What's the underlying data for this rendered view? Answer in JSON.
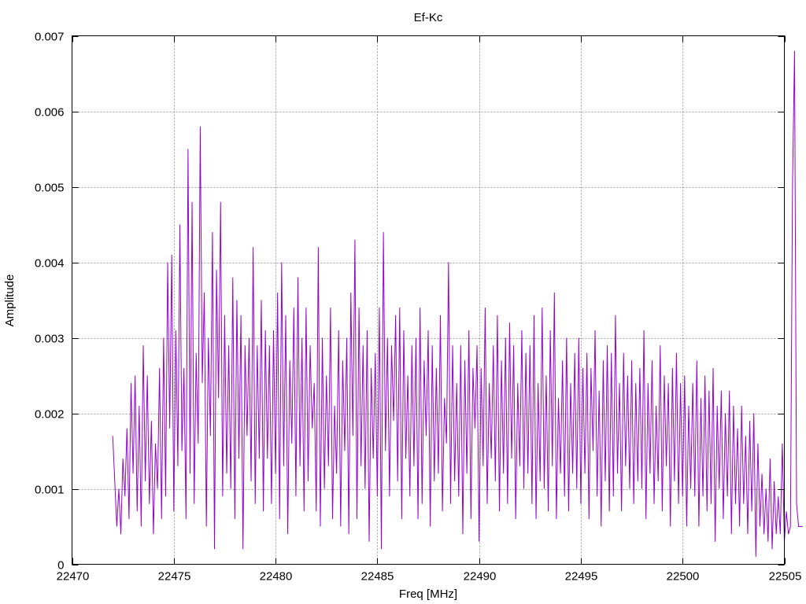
{
  "chart_data": {
    "type": "line",
    "title": "Ef-Kc",
    "xlabel": "Freq [MHz]",
    "ylabel": "Amplitude",
    "xlim": [
      22470,
      22505
    ],
    "ylim": [
      0,
      0.007
    ],
    "x_ticks": [
      22470,
      22475,
      22480,
      22485,
      22490,
      22495,
      22500,
      22505
    ],
    "x_tick_labels": [
      "22470",
      "22475",
      "22480",
      "22485",
      "22490",
      "22495",
      "22500",
      "22505"
    ],
    "y_ticks": [
      0,
      0.001,
      0.002,
      0.003,
      0.004,
      0.005,
      0.006,
      0.007
    ],
    "y_tick_labels": [
      "0",
      "0.001",
      "0.002",
      "0.003",
      "0.004",
      "0.005",
      "0.006",
      "0.007"
    ],
    "grid": true,
    "legend": "none",
    "series": [
      {
        "color": "#9400d3",
        "x_start": 22472.0,
        "x_step": 0.1,
        "values": [
          0.0017,
          0.0011,
          0.0005,
          0.001,
          0.0004,
          0.0014,
          0.0009,
          0.0018,
          0.0006,
          0.0024,
          0.0012,
          0.0025,
          0.0007,
          0.0021,
          0.0005,
          0.0029,
          0.0011,
          0.0025,
          0.0008,
          0.0019,
          0.0004,
          0.0016,
          0.001,
          0.0026,
          0.0006,
          0.003,
          0.0009,
          0.004,
          0.0018,
          0.0041,
          0.0007,
          0.0031,
          0.0013,
          0.0045,
          0.0015,
          0.0026,
          0.0006,
          0.0055,
          0.0012,
          0.0048,
          0.0008,
          0.0028,
          0.0016,
          0.0058,
          0.0024,
          0.0036,
          0.0005,
          0.003,
          0.0017,
          0.0044,
          0.0002,
          0.0039,
          0.0022,
          0.0048,
          0.0009,
          0.0033,
          0.0012,
          0.0029,
          0.001,
          0.0038,
          0.0006,
          0.0035,
          0.0014,
          0.0033,
          0.0002,
          0.0029,
          0.0017,
          0.003,
          0.0011,
          0.0042,
          0.0008,
          0.0029,
          0.0014,
          0.0035,
          0.0007,
          0.0031,
          0.0014,
          0.0029,
          0.0008,
          0.0031,
          0.0012,
          0.0036,
          0.0006,
          0.004,
          0.0013,
          0.0033,
          0.0004,
          0.0027,
          0.0016,
          0.0034,
          0.0009,
          0.0038,
          0.0013,
          0.003,
          0.0007,
          0.0034,
          0.0011,
          0.0029,
          0.0018,
          0.0024,
          0.0007,
          0.0042,
          0.0005,
          0.003,
          0.001,
          0.0025,
          0.0013,
          0.0034,
          0.0006,
          0.0021,
          0.0012,
          0.0031,
          0.0005,
          0.0027,
          0.0015,
          0.003,
          0.0004,
          0.0036,
          0.0017,
          0.0043,
          0.0006,
          0.0034,
          0.0013,
          0.0029,
          0.001,
          0.0031,
          0.0003,
          0.0026,
          0.0014,
          0.0028,
          0.0009,
          0.0034,
          0.0002,
          0.0044,
          0.0015,
          0.003,
          0.0009,
          0.0029,
          0.0019,
          0.0033,
          0.0011,
          0.0034,
          0.0006,
          0.0031,
          0.0014,
          0.0025,
          0.0009,
          0.0029,
          0.0013,
          0.003,
          0.0006,
          0.0034,
          0.0008,
          0.0027,
          0.0017,
          0.0031,
          0.0005,
          0.0029,
          0.0011,
          0.0026,
          0.0012,
          0.0033,
          0.0007,
          0.0022,
          0.0016,
          0.004,
          0.0008,
          0.0029,
          0.0011,
          0.0024,
          0.0009,
          0.0029,
          0.0004,
          0.0027,
          0.0012,
          0.0031,
          0.0006,
          0.0026,
          0.0018,
          0.0029,
          0.0003,
          0.0026,
          0.0013,
          0.0034,
          0.0008,
          0.0024,
          0.0014,
          0.0029,
          0.0011,
          0.0033,
          0.0007,
          0.0027,
          0.0012,
          0.003,
          0.0008,
          0.0032,
          0.0014,
          0.0029,
          0.0006,
          0.0024,
          0.0013,
          0.0031,
          0.001,
          0.0028,
          0.0012,
          0.0029,
          0.0008,
          0.0033,
          0.0006,
          0.0024,
          0.0011,
          0.0034,
          0.001,
          0.0025,
          0.0007,
          0.0031,
          0.0013,
          0.0036,
          0.0006,
          0.0022,
          0.0012,
          0.0027,
          0.0009,
          0.003,
          0.0007,
          0.0024,
          0.0012,
          0.0028,
          0.001,
          0.003,
          0.0008,
          0.0026,
          0.0012,
          0.0028,
          0.0006,
          0.0026,
          0.0015,
          0.0031,
          0.0009,
          0.0023,
          0.0005,
          0.0027,
          0.0011,
          0.0029,
          0.0007,
          0.0028,
          0.0009,
          0.0033,
          0.0012,
          0.0024,
          0.0007,
          0.0028,
          0.0013,
          0.0025,
          0.001,
          0.0027,
          0.0008,
          0.0024,
          0.0011,
          0.0026,
          0.001,
          0.0031,
          0.0006,
          0.0024,
          0.0012,
          0.0027,
          0.0008,
          0.0021,
          0.0011,
          0.0029,
          0.0007,
          0.0025,
          0.0013,
          0.0024,
          0.0005,
          0.0026,
          0.0011,
          0.0028,
          0.0008,
          0.0024,
          0.0009,
          0.0025,
          0.0005,
          0.0021,
          0.001,
          0.0024,
          0.0009,
          0.0027,
          0.0005,
          0.0022,
          0.0009,
          0.0025,
          0.0007,
          0.0023,
          0.0008,
          0.0026,
          0.0003,
          0.0021,
          0.001,
          0.0023,
          0.0006,
          0.002,
          0.0009,
          0.0023,
          0.0004,
          0.0021,
          0.0008,
          0.0018,
          0.0005,
          0.0021,
          0.0008,
          0.0017,
          0.0004,
          0.0019,
          0.0007,
          0.002,
          0.0001,
          0.0016,
          0.0005,
          0.0012,
          0.0004,
          0.001,
          0.0003,
          0.0014,
          0.0002,
          0.0011,
          0.0004,
          0.0009,
          0.0004,
          0.0016,
          0.0003,
          0.0007,
          0.0004,
          0.0005,
          0.005,
          0.0068,
          0.0008,
          0.0005,
          0.0005,
          0.0005
        ]
      }
    ]
  }
}
